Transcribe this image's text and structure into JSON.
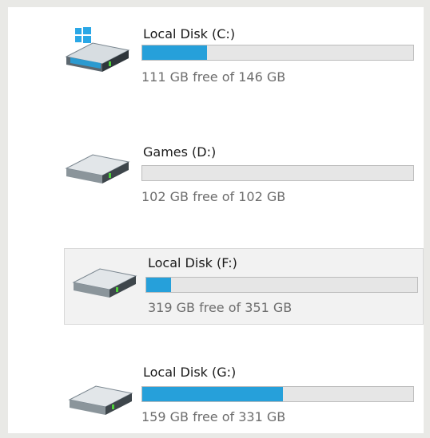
{
  "drives": [
    {
      "name": "Local Disk (C:)",
      "info": "111 GB free of 146 GB",
      "used_fraction": 0.24,
      "icon": "system-drive-icon"
    },
    {
      "name": "Games (D:)",
      "info": "102 GB free of 102 GB",
      "used_fraction": 0.0,
      "icon": "hard-drive-icon"
    },
    {
      "name": "Local Disk (F:)",
      "info": "319 GB free of 351 GB",
      "used_fraction": 0.09,
      "icon": "hard-drive-icon",
      "selected": true
    },
    {
      "name": "Local Disk (G:)",
      "info": "159 GB free of 331 GB",
      "used_fraction": 0.52,
      "icon": "hard-drive-icon"
    }
  ],
  "colors": {
    "bar_fill": "#26a0da",
    "bar_track": "#e6e6e6",
    "selection": "#f2f2f2"
  }
}
